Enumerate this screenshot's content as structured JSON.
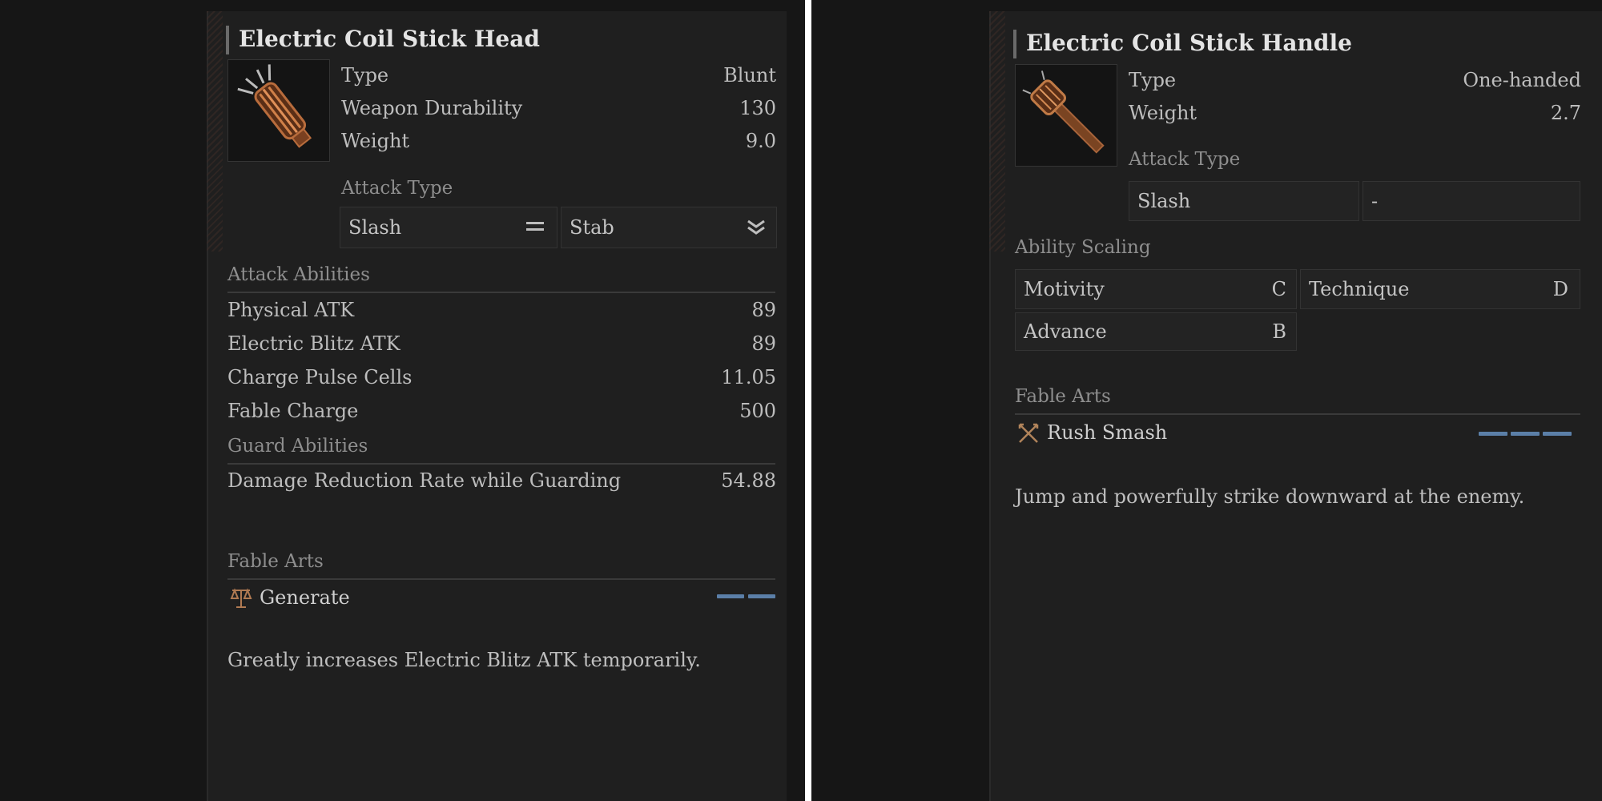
{
  "left": {
    "title": "Electric Coil Stick Head",
    "stats": [
      {
        "label": "Type",
        "value": "Blunt"
      },
      {
        "label": "Weapon Durability",
        "value": "130"
      },
      {
        "label": "Weight",
        "value": "9.0"
      }
    ],
    "attack_type_label": "Attack Type",
    "attack_types": [
      {
        "value": "Slash",
        "icon": "equals-icon"
      },
      {
        "value": "Stab",
        "icon": "double-chevron-down-icon"
      }
    ],
    "attack_abilities_label": "Attack Abilities",
    "attack_abilities": [
      {
        "label": "Physical ATK",
        "value": "89"
      },
      {
        "label": "Electric Blitz ATK",
        "value": "89"
      },
      {
        "label": "Charge Pulse Cells",
        "value": "11.05"
      },
      {
        "label": "Fable Charge",
        "value": "500"
      }
    ],
    "guard_abilities_label": "Guard Abilities",
    "guard_abilities": [
      {
        "label": "Damage Reduction Rate while Guarding",
        "value": "54.88"
      }
    ],
    "fable_arts_label": "Fable Arts",
    "fable_art": {
      "name": "Generate",
      "icon": "scales-icon",
      "slots": 2
    },
    "description": "Greatly increases Electric Blitz ATK temporarily."
  },
  "right": {
    "title": "Electric Coil Stick Handle",
    "stats": [
      {
        "label": "Type",
        "value": "One-handed"
      },
      {
        "label": "Weight",
        "value": "2.7"
      }
    ],
    "attack_type_label": "Attack Type",
    "attack_types": [
      {
        "value": "Slash"
      },
      {
        "value": "-"
      }
    ],
    "ability_scaling_label": "Ability Scaling",
    "ability_scaling": [
      {
        "label": "Motivity",
        "grade": "C"
      },
      {
        "label": "Technique",
        "grade": "D"
      },
      {
        "label": "Advance",
        "grade": "B"
      }
    ],
    "fable_arts_label": "Fable Arts",
    "fable_art": {
      "name": "Rush Smash",
      "icon": "crossed-swords-icon",
      "slots": 3
    },
    "description": "Jump and powerfully strike downward at the enemy."
  },
  "colors": {
    "background": "#161616",
    "panel": "#1f1f1f",
    "accent_slot": "#5b7fa8",
    "weapon_copper": "#a8643a"
  }
}
